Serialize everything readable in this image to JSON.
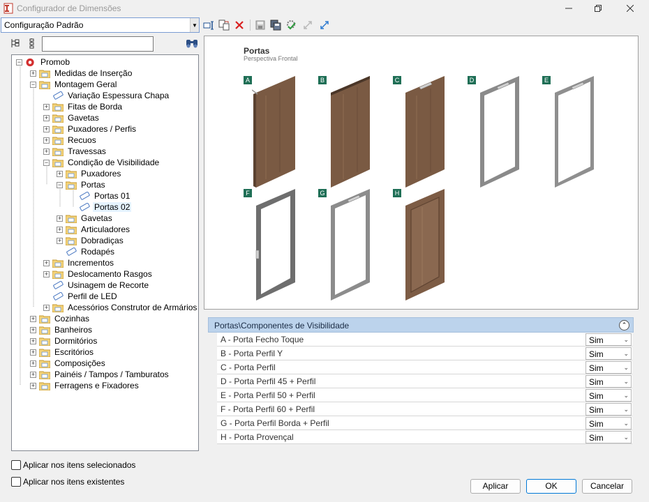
{
  "window": {
    "title": "Configurador de Dimensões",
    "minimize_icon": "minimize-icon",
    "maximize_icon": "restore-icon",
    "close_icon": "close-icon"
  },
  "toolbar": {
    "config_value": "Configuração Padrão",
    "icons": [
      "rename-icon",
      "copy-config-icon",
      "delete-icon",
      "save-icon",
      "save-all-icon",
      "apply-settings-icon",
      "shrink-icon",
      "expand-icon"
    ]
  },
  "tree": {
    "search_value": "",
    "items": [
      {
        "label": "Promob"
      },
      {
        "label": "Medidas de Inserção"
      },
      {
        "label": "Montagem Geral"
      },
      {
        "label": "Variação Espessura Chapa"
      },
      {
        "label": "Fitas de Borda"
      },
      {
        "label": "Gavetas"
      },
      {
        "label": "Puxadores / Perfis"
      },
      {
        "label": "Recuos"
      },
      {
        "label": "Travessas"
      },
      {
        "label": "Condição de Visibilidade"
      },
      {
        "label": "Puxadores"
      },
      {
        "label": "Portas"
      },
      {
        "label": "Portas 01"
      },
      {
        "label": "Portas 02"
      },
      {
        "label": "Gavetas"
      },
      {
        "label": "Articuladores"
      },
      {
        "label": "Dobradiças"
      },
      {
        "label": "Rodapés"
      },
      {
        "label": "Incrementos"
      },
      {
        "label": "Deslocamento Rasgos"
      },
      {
        "label": "Usinagem de Recorte"
      },
      {
        "label": "Perfil de LED"
      },
      {
        "label": "Acessórios Construtor de Armários"
      },
      {
        "label": "Cozinhas"
      },
      {
        "label": "Banheiros"
      },
      {
        "label": "Dormitórios"
      },
      {
        "label": "Escritórios"
      },
      {
        "label": "Composições"
      },
      {
        "label": "Painéis / Tampos / Tamburatos"
      },
      {
        "label": "Ferragens e Fixadores"
      }
    ]
  },
  "preview": {
    "title": "Portas",
    "subtitle": "Perspectiva Frontal",
    "doors": [
      "A",
      "B",
      "C",
      "D",
      "E",
      "F",
      "G",
      "H"
    ]
  },
  "grid": {
    "header": "Portas\\Componentes de Visibilidade",
    "rows": [
      {
        "label": "A - Porta Fecho Toque",
        "value": "Sim"
      },
      {
        "label": "B - Porta Perfil Y",
        "value": "Sim"
      },
      {
        "label": "C - Porta Perfil",
        "value": "Sim"
      },
      {
        "label": "D - Porta Perfil 45 + Perfil",
        "value": "Sim"
      },
      {
        "label": "E - Porta Perfil 50 + Perfil",
        "value": "Sim"
      },
      {
        "label": "F - Porta Perfil 60 + Perfil",
        "value": "Sim"
      },
      {
        "label": "G - Porta Perfil Borda + Perfil",
        "value": "Sim"
      },
      {
        "label": "H - Porta Provençal",
        "value": "Sim"
      }
    ]
  },
  "options": {
    "apply_selected": "Aplicar nos itens selecionados",
    "apply_existing": "Aplicar nos itens existentes"
  },
  "buttons": {
    "apply": "Aplicar",
    "ok": "OK",
    "cancel": "Cancelar"
  }
}
